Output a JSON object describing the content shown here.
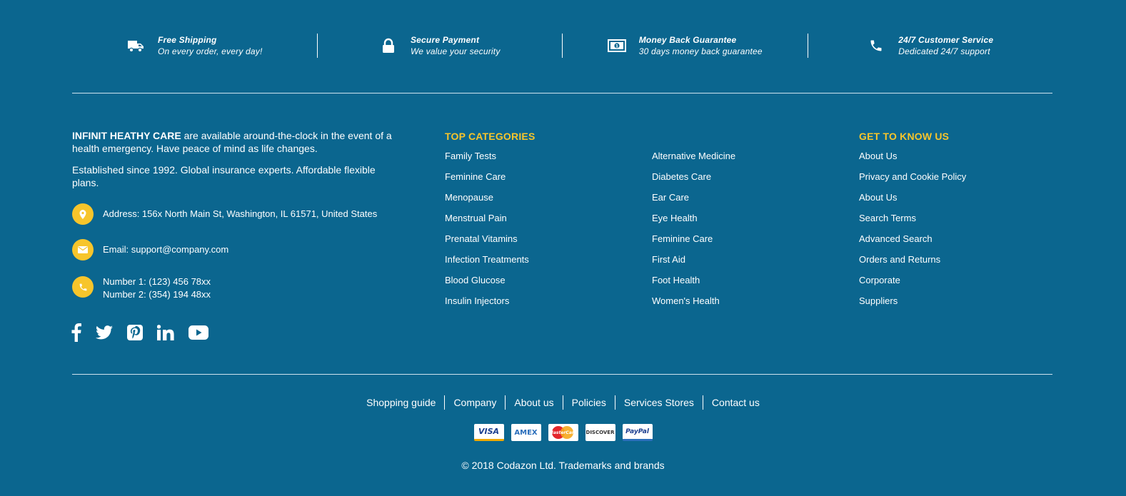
{
  "features": [
    {
      "icon": "truck-icon",
      "title": "Free Shipping",
      "subtitle": "On every order, every day!"
    },
    {
      "icon": "lock-icon",
      "title": "Secure Payment",
      "subtitle": "We value your security"
    },
    {
      "icon": "money-icon",
      "title": "Money Back Guarantee",
      "subtitle": "30 days money back guarantee"
    },
    {
      "icon": "phone-icon",
      "title": "24/7 Customer Service",
      "subtitle": "Dedicated 24/7 support"
    }
  ],
  "about": {
    "brand": "INFINIT HEATHY CARE",
    "intro_rest": " are available around-the-clock in the event of a health emergency. Have peace of mind as life changes.",
    "established": "Established since 1992. Global insurance experts. Affordable flexible plans.",
    "address": "Address: 156x North Main St, Washington, IL 61571, United States",
    "email": "Email: support@company.com",
    "phone1": "Number 1: (123) 456 78xx",
    "phone2": "Number 2: (354) 194 48xx"
  },
  "social": [
    "facebook-icon",
    "twitter-icon",
    "pinterest-icon",
    "linkedin-icon",
    "youtube-icon"
  ],
  "top_categories": {
    "title": "TOP CATEGORIES",
    "col1": [
      "Family Tests",
      "Feminine Care",
      "Menopause",
      "Menstrual Pain",
      "Prenatal Vitamins",
      "Infection Treatments",
      "Blood Glucose",
      "Insulin Injectors"
    ],
    "col2": [
      "Alternative Medicine",
      "Diabetes Care",
      "Ear Care",
      "Eye Health",
      "Feminine Care",
      "First Aid",
      "Foot Health",
      "Women's Health"
    ]
  },
  "get_to_know": {
    "title": "GET TO KNOW US",
    "items": [
      "About Us",
      "Privacy and Cookie Policy",
      "About Us",
      "Search Terms",
      "Advanced Search",
      "Orders and Returns",
      "Corporate",
      "Suppliers"
    ]
  },
  "bottom_links": [
    "Shopping guide",
    "Company",
    "About us",
    "Policies",
    "Services Stores",
    "Contact us"
  ],
  "payments": {
    "visa": "VISA",
    "amex": "AMEX",
    "mastercard": "MasterCard",
    "discover": "DISCOVER",
    "paypal": "PayPal"
  },
  "copyright": "© 2018 Codazon Ltd. Trademarks and brands",
  "colors": {
    "background": "#0b668f",
    "accent": "#f7c52b"
  }
}
